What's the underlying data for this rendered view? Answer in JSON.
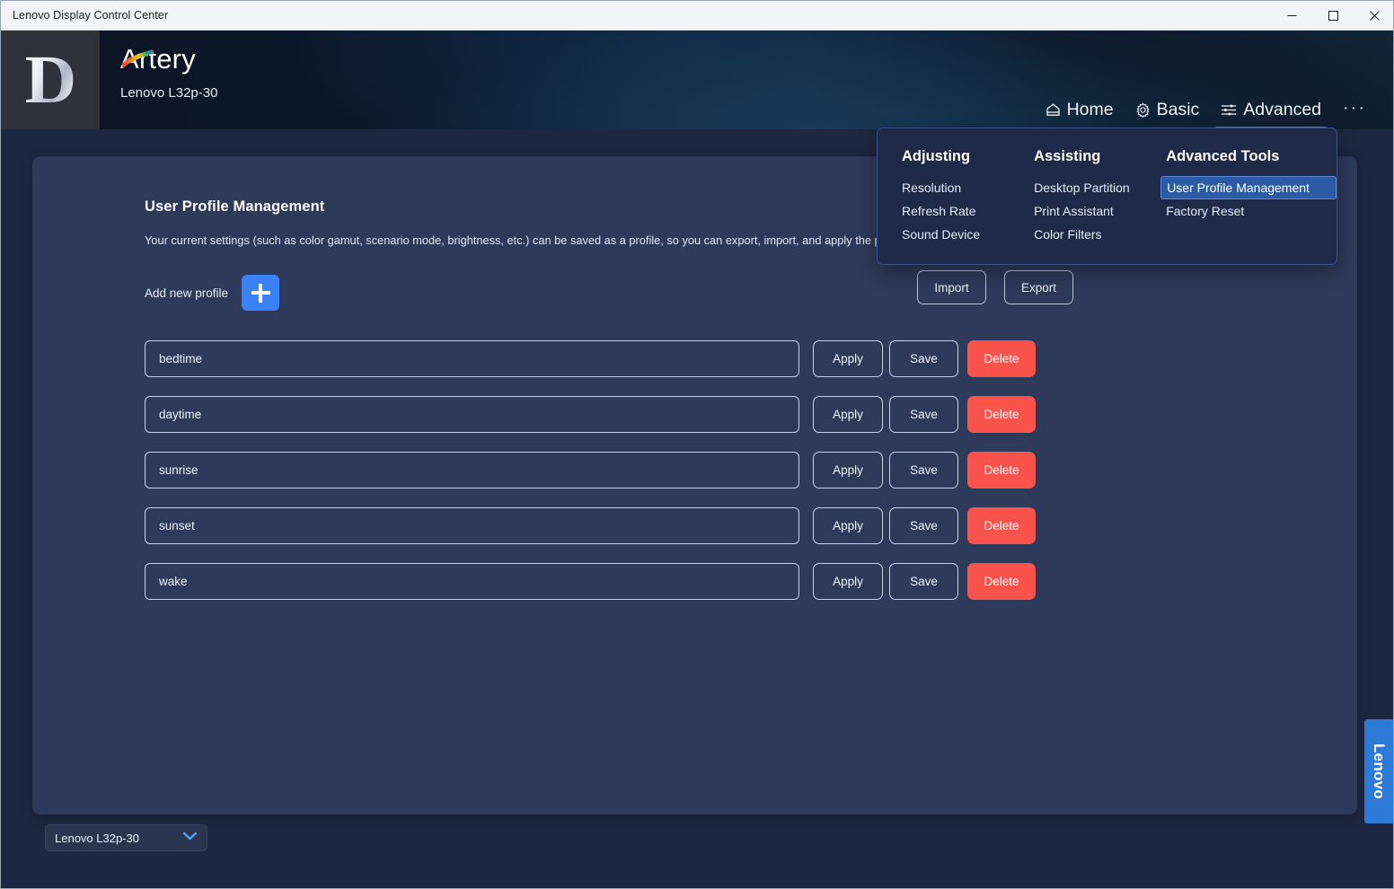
{
  "window": {
    "title": "Lenovo Display Control Center",
    "controls": {
      "minimize": "minimize-icon",
      "maximize": "maximize-icon",
      "close": "close-icon"
    }
  },
  "header": {
    "app_icon_letter": "D",
    "brand_name": "Artery",
    "brand_initial": "A",
    "brand_rest": "rtery",
    "monitor_model": "Lenovo L32p-30",
    "nav": [
      {
        "label": "Home",
        "icon": "home-icon",
        "active": false
      },
      {
        "label": "Basic",
        "icon": "gear-icon",
        "active": false
      },
      {
        "label": "Advanced",
        "icon": "sliders-icon",
        "active": true
      }
    ],
    "overflow": "···"
  },
  "menu": {
    "columns": [
      {
        "heading": "Adjusting",
        "items": [
          {
            "label": "Resolution",
            "selected": false
          },
          {
            "label": "Refresh Rate",
            "selected": false
          },
          {
            "label": "Sound Device",
            "selected": false
          }
        ]
      },
      {
        "heading": "Assisting",
        "items": [
          {
            "label": "Desktop Partition",
            "selected": false
          },
          {
            "label": "Print Assistant",
            "selected": false
          },
          {
            "label": "Color Filters",
            "selected": false
          }
        ]
      },
      {
        "heading": "Advanced Tools",
        "items": [
          {
            "label": "User Profile Management",
            "selected": true
          },
          {
            "label": "Factory Reset",
            "selected": false
          }
        ]
      }
    ]
  },
  "main": {
    "title": "User Profile Management",
    "description": "Your current settings (such as color gamut, scenario mode, brightness, etc.) can be saved as a profile, so you can export, import, and apply the profile wher",
    "add_new_profile_label": "Add new profile",
    "add_button_icon": "plus-icon",
    "import_label": "Import",
    "export_label": "Export",
    "row_buttons": {
      "apply": "Apply",
      "save": "Save",
      "delete": "Delete"
    },
    "profiles": [
      {
        "name": "bedtime"
      },
      {
        "name": "daytime"
      },
      {
        "name": "sunrise"
      },
      {
        "name": "sunset"
      },
      {
        "name": "wake"
      }
    ]
  },
  "footer": {
    "monitor_select_value": "Lenovo L32p-30",
    "monitor_select_icon": "chevron-down-icon"
  },
  "side_tab": {
    "label": "Lenovo"
  },
  "colors": {
    "accent_blue": "#3b82f6",
    "delete_red": "#f9534b",
    "panel_bg": "#2e3a59",
    "app_bg": "#1e2741",
    "menu_bg": "#1e2a48",
    "menu_selected": "#2c5aa3",
    "lenovo_blue": "#2d7bd6",
    "header_dark": "#0b1423"
  }
}
